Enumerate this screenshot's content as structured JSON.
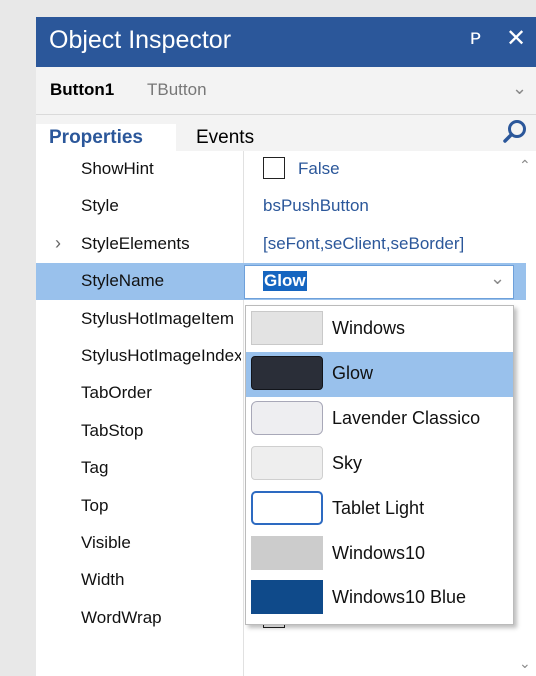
{
  "window": {
    "title": "Object Inspector",
    "pin_glyph": "ᴩ",
    "close_glyph": "✕"
  },
  "object": {
    "name": "Button1",
    "type": "TButton"
  },
  "tabs": {
    "properties": "Properties",
    "events": "Events"
  },
  "properties": [
    {
      "name": "ShowHint",
      "value": "False",
      "kind": "checkbox"
    },
    {
      "name": "Style",
      "value": "bsPushButton",
      "kind": "text"
    },
    {
      "name": "StyleElements",
      "value": "[seFont,seClient,seBorder]",
      "kind": "text",
      "expandable": true
    },
    {
      "name": "StyleName",
      "value": "Glow",
      "kind": "combo",
      "selected": true
    },
    {
      "name": "StylusHotImageItem",
      "value": "",
      "kind": "text"
    },
    {
      "name": "StylusHotImageIndex",
      "value": "",
      "kind": "text"
    },
    {
      "name": "TabOrder",
      "value": "",
      "kind": "text"
    },
    {
      "name": "TabStop",
      "value": "",
      "kind": "text"
    },
    {
      "name": "Tag",
      "value": "",
      "kind": "text"
    },
    {
      "name": "Top",
      "value": "",
      "kind": "text"
    },
    {
      "name": "Visible",
      "value": "",
      "kind": "text"
    },
    {
      "name": "Width",
      "value": "",
      "kind": "text"
    },
    {
      "name": "WordWrap",
      "value": "False",
      "kind": "checkbox"
    }
  ],
  "dropdown": {
    "selected": "Glow",
    "items": [
      {
        "label": "Windows",
        "swatch": "windows"
      },
      {
        "label": "Glow",
        "swatch": "glow"
      },
      {
        "label": "Lavender Classico",
        "swatch": "lavender"
      },
      {
        "label": "Sky",
        "swatch": "sky"
      },
      {
        "label": "Tablet Light",
        "swatch": "tablet"
      },
      {
        "label": "Windows10",
        "swatch": "win10"
      },
      {
        "label": "Windows10 Blue",
        "swatch": "win10blue"
      }
    ]
  },
  "colors": {
    "titlebar": "#2b579a",
    "accent": "#2b579a",
    "selection": "#99c1ec",
    "text_selection": "#1565c0"
  }
}
